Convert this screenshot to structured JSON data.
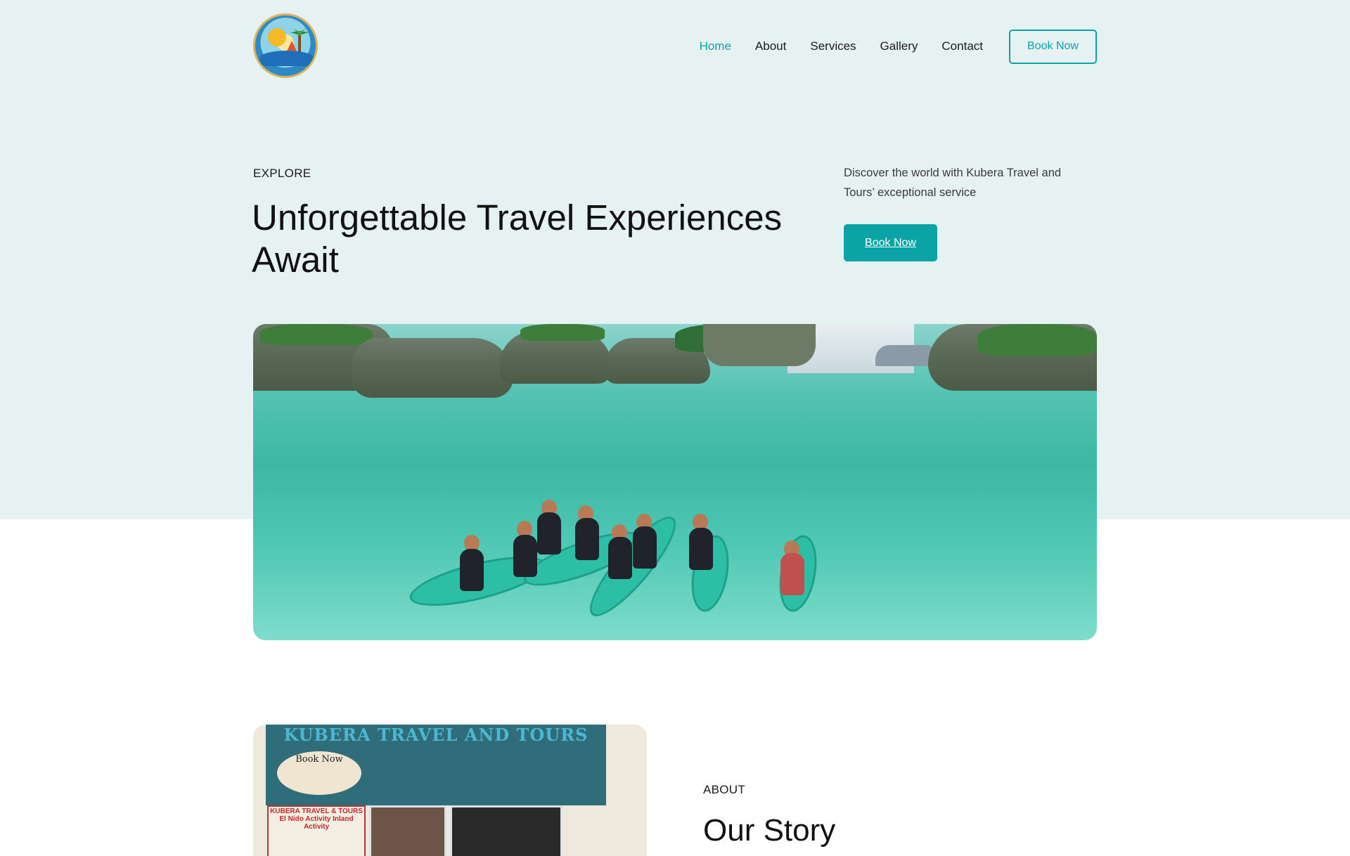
{
  "nav": {
    "items": [
      {
        "label": "Home",
        "active": true
      },
      {
        "label": "About",
        "active": false
      },
      {
        "label": "Services",
        "active": false
      },
      {
        "label": "Gallery",
        "active": false
      },
      {
        "label": "Contact",
        "active": false
      }
    ],
    "book_label": "Book Now"
  },
  "logo": {
    "text": "Kubera Travel & Tours"
  },
  "hero": {
    "eyebrow": "EXPLORE",
    "title": "Unforgettable Travel Experiences Await",
    "description": "Discover the world with Kubera Travel and Tours’ exceptional service",
    "cta_label": "Book Now"
  },
  "about": {
    "eyebrow": "ABOUT",
    "title": "Our Story",
    "image": {
      "banner_title": "KUBERA TRAVEL AND TOURS",
      "oval_text": "Book Now",
      "poster_text": "KUBERA TRAVEL & TOURS El Nido Activity Inland Activity"
    }
  },
  "colors": {
    "accent": "#0aa3a6",
    "hero_bg": "#e6f2f2",
    "text": "#111111"
  }
}
